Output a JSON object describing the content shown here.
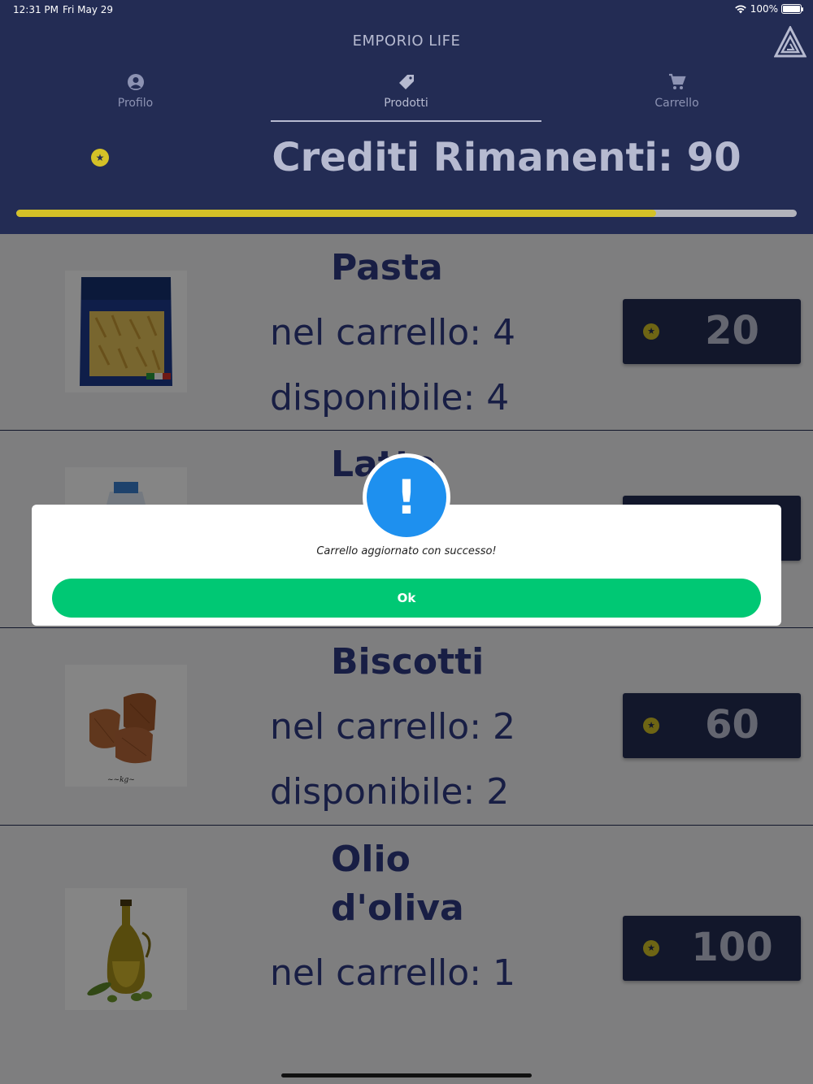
{
  "status_bar": {
    "time": "12:31 PM",
    "date": "Fri May 29",
    "battery": "100%"
  },
  "header": {
    "app_title": "EMPORIO LIFE",
    "logo_icon": "triangle-logo-icon",
    "tabs": [
      {
        "label": "Profilo",
        "icon": "user-icon",
        "active": false
      },
      {
        "label": "Prodotti",
        "icon": "tag-icon",
        "active": true
      },
      {
        "label": "Carrello",
        "icon": "cart-icon",
        "active": false
      }
    ]
  },
  "credits": {
    "label": "Crediti Rimanenti: 90",
    "progress_fraction": 0.82
  },
  "products": [
    {
      "name": "Pasta",
      "in_cart": "nel carrello: 4",
      "available": "disponibile: 4",
      "price": "20"
    },
    {
      "name": "Latte",
      "price": ""
    },
    {
      "name": "Biscotti",
      "in_cart": "nel carrello: 2",
      "available": "disponibile: 2",
      "price": "60"
    },
    {
      "name_line1": "Olio",
      "name_line2": "d'oliva",
      "in_cart": "nel carrello: 1",
      "price": "100"
    }
  ],
  "dialog": {
    "message": "Carrello aggiornato con successo!",
    "ok_label": "Ok",
    "icon": "exclamation-icon"
  },
  "colors": {
    "navy": "#232c54",
    "text_blue": "#2f3a83",
    "gold": "#d4c127",
    "green": "#00c874",
    "alert_blue": "#1e90ef"
  }
}
